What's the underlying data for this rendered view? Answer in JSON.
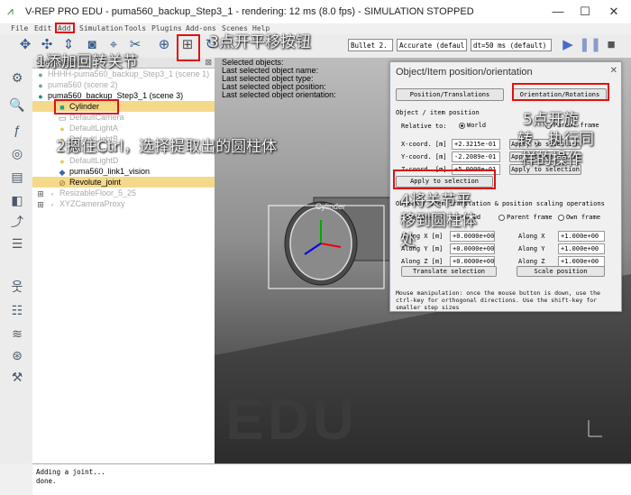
{
  "window": {
    "title": "V-REP PRO EDU - puma560_backup_Step3_1 - rendering: 12 ms (8.0 fps) - SIMULATION STOPPED",
    "minimize": "—",
    "maximize": "☐",
    "close": "✕"
  },
  "menu": [
    "File",
    "Edit",
    "Add",
    "Simulation",
    "Tools",
    "Plugins",
    "Add-ons",
    "Scenes",
    "Help"
  ],
  "toolbar": {
    "engine_combo": "Bullet 2.",
    "accuracy_combo": "Accurate (defaul",
    "dt_combo": "dt=50 ms (default)",
    "play_icon": "play-icon",
    "pause_icon": "pause-icon"
  },
  "hierarchy": {
    "header": "Scene hierarchy",
    "items": [
      {
        "label": "HHHH-puma560_backup_Step3_1 (scene 1)",
        "muted": true
      },
      {
        "label": "puma560 (scene 2)",
        "muted": true
      },
      {
        "label": "puma560_backup_Step3_1 (scene 3)",
        "muted": false
      },
      {
        "label": "Cylinder",
        "muted": false
      },
      {
        "label": "DefaultCamera",
        "muted": true
      },
      {
        "label": "DefaultLightA",
        "muted": true
      },
      {
        "label": "DefaultLightB",
        "muted": true
      },
      {
        "label": "DefaultLightC",
        "muted": true
      },
      {
        "label": "DefaultLightD",
        "muted": true
      },
      {
        "label": "puma560_link1_vision",
        "muted": false
      },
      {
        "label": "Revolute_joint",
        "muted": false
      },
      {
        "label": "ResizableFloor_5_25",
        "muted": true
      },
      {
        "label": "XYZCameraProxy",
        "muted": true
      }
    ]
  },
  "selection_info": {
    "line1": "Selected objects:",
    "line2": "Last selected object name:",
    "line3": "Last selected object type:",
    "line4": "Last selected object position:",
    "line5": "Last selected object orientation:"
  },
  "scene": {
    "cylinder_label": "Cylinder",
    "watermark": "EDU"
  },
  "dialog": {
    "title": "Object/Item position/orientation",
    "tab_position": "Position/Translations",
    "tab_orientation": "Orientation/Rotations",
    "section_object": "Object / item position",
    "relative_to": "Relative to:",
    "world": "World",
    "parent_frame": "Parent frame",
    "x_label": "X-coord. [m]",
    "x_value": "+2.3215e-01",
    "y_label": "Y-coord. [m]",
    "y_value": "-2.2089e-01",
    "z_label": "Z-coord. [m]",
    "z_value": "+5.0000e-01",
    "apply_selection_btn": "Apply to selection",
    "apply_to_selection": "Apply to selection",
    "section_translation": "Object / item translation & position scaling operations",
    "relative_to2": "Relative to:",
    "world2": "World",
    "parent_frame2": "Parent frame",
    "own_frame": "Own frame",
    "along_x_label": "Along X [m]",
    "along_x_value": "+0.0000e+00",
    "along_y_label": "Along Y [m]",
    "along_y_value": "+0.0000e+00",
    "along_z_label": "Along Z [m]",
    "along_z_value": "+0.0000e+00",
    "scale_x_label": "Along X",
    "scale_x_value": "+1.000e+00",
    "scale_y_label": "Along Y",
    "scale_y_value": "+1.000e+00",
    "scale_z_label": "Along Z",
    "scale_z_value": "+1.000e+00",
    "translate_btn": "Translate selection",
    "scale_btn": "Scale position",
    "help_text": "Mouse manipulation: once the mouse button is down, use the ctrl-key for orthogonal directions. Use the shift-key for smaller step sizes"
  },
  "console": {
    "line1": "Adding a joint...",
    "line2": "done."
  },
  "annotations": {
    "a1": "1添加回转关节",
    "a2": "2摁住Ctrl，选择提取出的圆柱体",
    "a3": "3点开平移按钮",
    "a4_1": "4将关节平",
    "a4_2": "移到圆柱体",
    "a4_3": "处",
    "a5_1": "5点开旋",
    "a5_2": "转，执行同",
    "a5_3": "样的操作"
  },
  "colors": {
    "annotation_box": "#e01010",
    "selection_highlight": "#f5d98a"
  }
}
